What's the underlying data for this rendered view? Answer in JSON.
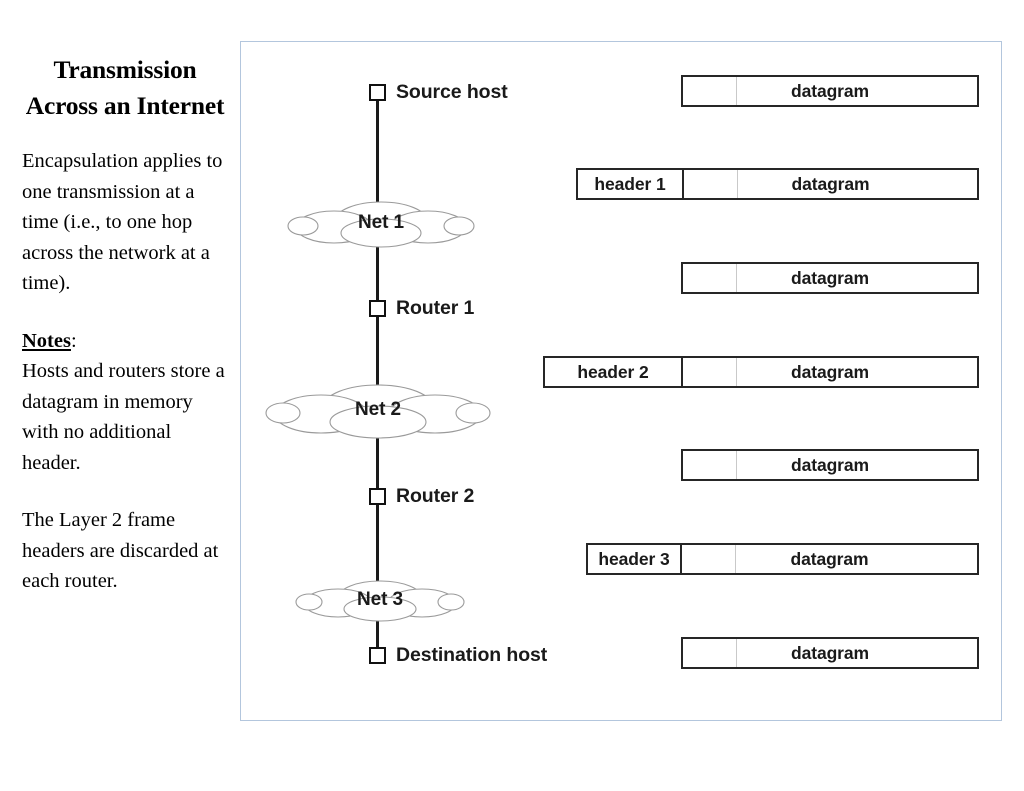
{
  "slide": {
    "title": "Transmission Across an Internet",
    "paragraphs": [
      "Encapsulation applies to one transmission at a time (i.e., to one hop across the network at a time).",
      "The Layer 2 frame headers are discarded at each router."
    ],
    "notes_label": "Notes",
    "notes_colon": ":",
    "notes_text": "Hosts and routers store a datagram in memory with no additional header."
  },
  "diagram": {
    "nodes": [
      {
        "type": "host",
        "label": "Source host"
      },
      {
        "type": "cloud",
        "label": "Net 1"
      },
      {
        "type": "router",
        "label": "Router 1"
      },
      {
        "type": "cloud",
        "label": "Net 2"
      },
      {
        "type": "router",
        "label": "Router 2"
      },
      {
        "type": "cloud",
        "label": "Net 3"
      },
      {
        "type": "host",
        "label": "Destination host"
      }
    ]
  },
  "packets": [
    {
      "header": null,
      "data": "datagram"
    },
    {
      "header": "header 1",
      "data": "datagram"
    },
    {
      "header": null,
      "data": "datagram"
    },
    {
      "header": "header 2",
      "data": "datagram"
    },
    {
      "header": null,
      "data": "datagram"
    },
    {
      "header": "header 3",
      "data": "datagram"
    },
    {
      "header": null,
      "data": "datagram"
    }
  ],
  "colors": {
    "panel_border": "#b3c6dd",
    "ink": "#1a1a1a",
    "box_border": "#262626",
    "cloud_outline": "#9a9a9a"
  }
}
